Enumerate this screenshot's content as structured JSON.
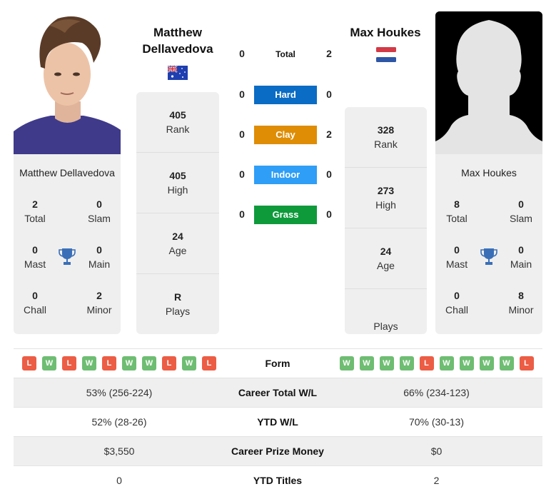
{
  "player1": {
    "name_header_line1": "Matthew",
    "name_header_line2": "Dellavedova",
    "name": "Matthew Dellavedova",
    "country": "Australia",
    "flag_icon": "australia-flag-icon",
    "titles": {
      "total": {
        "value": "2",
        "label": "Total"
      },
      "slam": {
        "value": "0",
        "label": "Slam"
      },
      "mast": {
        "value": "0",
        "label": "Mast"
      },
      "main": {
        "value": "0",
        "label": "Main"
      },
      "chall": {
        "value": "0",
        "label": "Chall"
      },
      "minor": {
        "value": "2",
        "label": "Minor"
      }
    },
    "stats": [
      {
        "value": "405",
        "label": "Rank"
      },
      {
        "value": "405",
        "label": "High"
      },
      {
        "value": "24",
        "label": "Age"
      },
      {
        "value": "R",
        "label": "Plays"
      }
    ],
    "form": [
      "L",
      "W",
      "L",
      "W",
      "L",
      "W",
      "W",
      "L",
      "W",
      "L"
    ]
  },
  "player2": {
    "name_header": "Max Houkes",
    "name": "Max Houkes",
    "country": "Netherlands",
    "flag_icon": "netherlands-flag-icon",
    "titles": {
      "total": {
        "value": "8",
        "label": "Total"
      },
      "slam": {
        "value": "0",
        "label": "Slam"
      },
      "mast": {
        "value": "0",
        "label": "Mast"
      },
      "main": {
        "value": "0",
        "label": "Main"
      },
      "chall": {
        "value": "0",
        "label": "Chall"
      },
      "minor": {
        "value": "8",
        "label": "Minor"
      }
    },
    "stats": [
      {
        "value": "328",
        "label": "Rank"
      },
      {
        "value": "273",
        "label": "High"
      },
      {
        "value": "24",
        "label": "Age"
      },
      {
        "value": "",
        "label": "Plays"
      }
    ],
    "form": [
      "W",
      "W",
      "W",
      "W",
      "L",
      "W",
      "W",
      "W",
      "W",
      "L"
    ]
  },
  "h2h": [
    {
      "label": "Total",
      "p1": "0",
      "p2": "2",
      "color": ""
    },
    {
      "label": "Hard",
      "p1": "0",
      "p2": "0",
      "color": "#0a6cc4"
    },
    {
      "label": "Clay",
      "p1": "0",
      "p2": "2",
      "color": "#df8d05"
    },
    {
      "label": "Indoor",
      "p1": "0",
      "p2": "0",
      "color": "#2e9ef6"
    },
    {
      "label": "Grass",
      "p1": "0",
      "p2": "0",
      "color": "#0e9a3b"
    }
  ],
  "comparison": {
    "form_label": "Form",
    "rows": [
      {
        "label": "Career Total W/L",
        "p1": "53% (256-224)",
        "p2": "66% (234-123)"
      },
      {
        "label": "YTD W/L",
        "p1": "52% (28-26)",
        "p2": "70% (30-13)"
      },
      {
        "label": "Career Prize Money",
        "p1": "$3,550",
        "p2": "$0"
      },
      {
        "label": "YTD Titles",
        "p1": "0",
        "p2": "2"
      }
    ]
  },
  "colors": {
    "win": "#6ebd72",
    "loss": "#ec5d45",
    "trophy": "#3a6fb8",
    "card_bg": "#efefef"
  }
}
